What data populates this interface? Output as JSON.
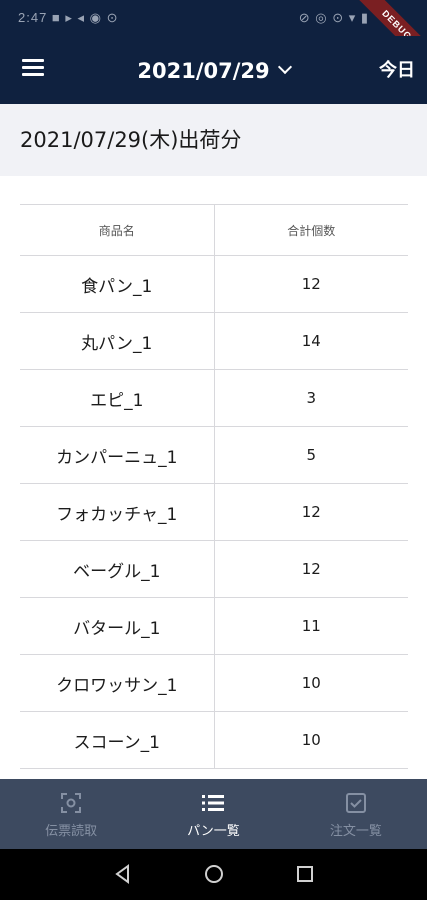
{
  "status_bar": {
    "left": "2:47 ■ ▸ ◂ ◉ ⊙",
    "right": "⊘ ◎ ⊙ ▾ ▮"
  },
  "debug_label": "DEBUG",
  "app_bar": {
    "date": "2021/07/29",
    "today_label": "今日"
  },
  "section": {
    "title": "2021/07/29(木)出荷分"
  },
  "table": {
    "headers": [
      "商品名",
      "合計個数"
    ],
    "rows": [
      {
        "name": "食パン_1",
        "qty": "12"
      },
      {
        "name": "丸パン_1",
        "qty": "14"
      },
      {
        "name": "エピ_1",
        "qty": "3"
      },
      {
        "name": "カンパーニュ_1",
        "qty": "5"
      },
      {
        "name": "フォカッチャ_1",
        "qty": "12"
      },
      {
        "name": "ベーグル_1",
        "qty": "12"
      },
      {
        "name": "バタール_1",
        "qty": "11"
      },
      {
        "name": "クロワッサン_1",
        "qty": "10"
      },
      {
        "name": "スコーン_1",
        "qty": "10"
      }
    ]
  },
  "bottom_nav": {
    "items": [
      {
        "label": "伝票読取",
        "icon": "scan-icon",
        "active": false
      },
      {
        "label": "パン一覧",
        "icon": "list-icon",
        "active": true
      },
      {
        "label": "注文一覧",
        "icon": "checkbox-icon",
        "active": false
      }
    ]
  },
  "colors": {
    "app_bar": "#0f213f",
    "bottom_nav": "#3d4a60",
    "section_bg": "#f1f2f6",
    "debug": "#7a1f22"
  }
}
